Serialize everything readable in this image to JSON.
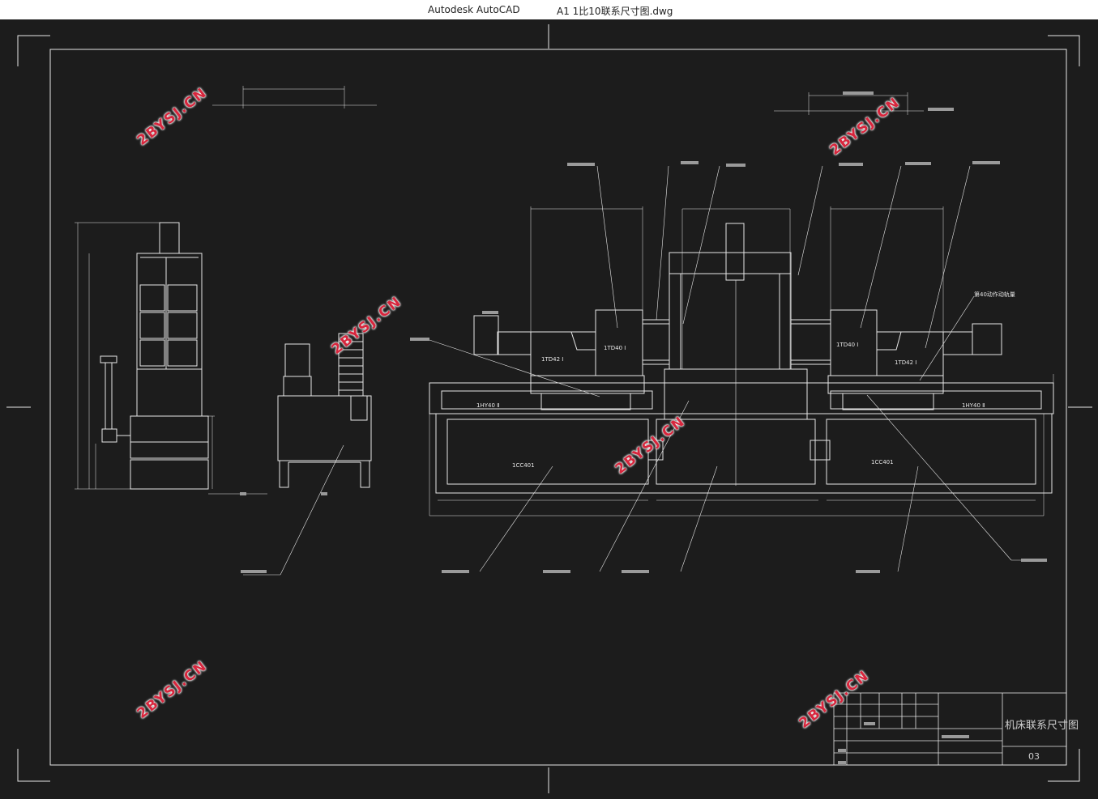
{
  "window": {
    "app_name": "Autodesk AutoCAD",
    "document_name": "A1 1比10联系尺寸图.dwg"
  },
  "watermark": {
    "text": "2BYSJ.CN"
  },
  "labels": {
    "head_left": "1TD42 Ⅰ",
    "head_left_center": "1TD40 Ⅰ",
    "head_right_center": "1TD40 Ⅰ",
    "head_right": "1TD42 Ⅰ",
    "slide_left": "1HY40 Ⅱ",
    "slide_right": "1HY40 Ⅱ",
    "base_left": "1CC401",
    "base_right": "1CC401",
    "callout_right": "第40动作动轨量"
  },
  "title_block": {
    "drawing_name": "机床联系尺寸图",
    "sheet_number": "03"
  },
  "colors": {
    "background": "#1c1c1c",
    "line": "#e6e6e6",
    "watermark": "#d7263d"
  }
}
